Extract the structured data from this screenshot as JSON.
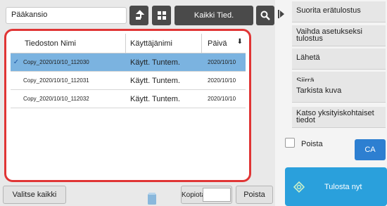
{
  "folder": {
    "label": "Pääkansio"
  },
  "toolbar": {
    "all_files_label": "Kaikki Tied."
  },
  "table": {
    "headers": {
      "name": "Tiedoston Nimi",
      "user": "Käyttäjänimi",
      "date": "Päivä"
    },
    "rows": [
      {
        "name": "Copy_2020/10/10_112030",
        "user": "Käytt. Tuntem.",
        "date": "2020/10/10",
        "selected": true
      },
      {
        "name": "Copy_2020/10/10_112031",
        "user": "Käytt. Tuntem.",
        "date": "2020/10/10",
        "selected": false
      },
      {
        "name": "Copy_2020/10/10_112032",
        "user": "Käytt. Tuntem.",
        "date": "2020/10/10",
        "selected": false
      }
    ]
  },
  "bottom": {
    "select_all_label": "Valitse kaikki",
    "copies_label": "Kopiota",
    "copies_value": "",
    "delete_label": "Poista"
  },
  "actions": [
    "Suorita erätulostus",
    "Vaihda asetukseksi tulostus",
    "Lähetä",
    "Siirrä",
    "Tarkista kuva",
    "Katso yksityiskohtaiset tiedot"
  ],
  "delete_option": {
    "label": "Poista",
    "checked": false
  },
  "ca_label": "CA",
  "print_label": "Tulosta nyt",
  "colors": {
    "selected_row": "#7bb3e0",
    "frame": "#e03535",
    "print_button": "#2aa0dc",
    "ca_button": "#2d7fd1"
  },
  "icons": {
    "up": "folder-up-icon",
    "grid": "grid-view-icon",
    "search": "search-icon",
    "sort": "sort-down-icon",
    "trash": "trash-icon",
    "print": "start-icon",
    "expand": "expand-arrow-icon"
  }
}
